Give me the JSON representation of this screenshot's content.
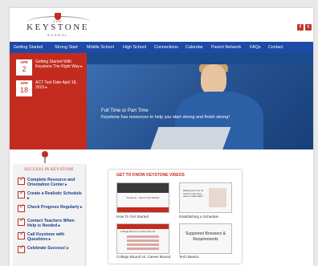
{
  "header": {
    "logo": {
      "the": "THE",
      "name": "KEYSTONE",
      "school": "SCHOOL"
    },
    "social": [
      {
        "icon": "facebook-icon",
        "glyph": "f"
      },
      {
        "icon": "twitter-icon",
        "glyph": "t"
      }
    ]
  },
  "nav": {
    "items": [
      "Getting Started",
      "Strong Start",
      "Middle School",
      "High School",
      "Connections",
      "Calendar",
      "Parent Network",
      "FAQs",
      "Contact"
    ]
  },
  "events": [
    {
      "month": "APR",
      "day": "2",
      "title": "Getting Started With Keystone The Right Way ▸"
    },
    {
      "month": "APR",
      "day": "18",
      "title": "ACT Test Date April 18, 2015 ▸"
    }
  ],
  "hero": {
    "caption_title": "Full Time or Part Time",
    "caption_text": "Keystone has resources to help you start strong and finish strong!"
  },
  "sidebar": {
    "title": "SUCCESS IN KEYSTONE",
    "items": [
      "Complete Resource and Orientation Center ▸",
      "Create a Realistic Schedule ▸",
      "Check Progress Regularly ▸",
      "Contact Teachers When Help is Needed ▸",
      "Call Keystone with Questions ▸",
      "Celebrate Success! ▸"
    ]
  },
  "videos": {
    "title": "GET TO KNOW KEYSTONE VIDEOS",
    "items": [
      {
        "caption": "How To Get Started",
        "thumb_text": "Keystone - How to Get Started"
      },
      {
        "caption": "Establishing a Schedule",
        "thumb_text": "Making the time for school: How long does it really take?"
      },
      {
        "caption": "College Bound vs. Career Bound",
        "thumb_text": "College Bound vs Career Bound"
      },
      {
        "caption": "Tech Basics",
        "thumb_text": "Supported Browsers & Requirements"
      }
    ]
  },
  "colors": {
    "brand_red": "#c42b1f",
    "nav_blue": "#1d4aa6",
    "link_blue": "#1a3f8c"
  }
}
